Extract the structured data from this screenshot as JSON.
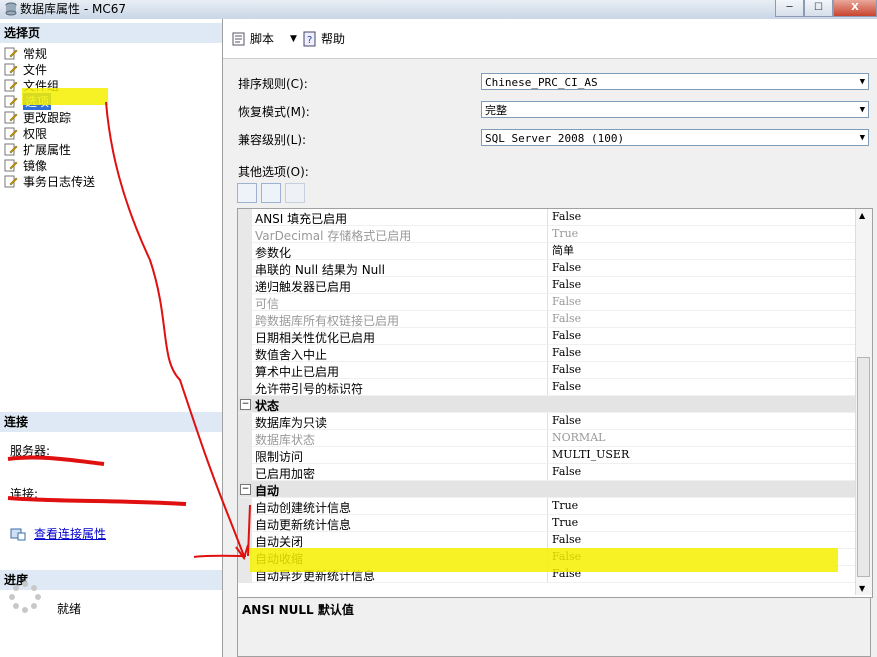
{
  "window": {
    "title": "数据库属性 - MC67",
    "buttons": [
      "─",
      "☐",
      "X"
    ]
  },
  "sidebar": {
    "select_page_header": "选择页",
    "items": [
      {
        "label": "常规"
      },
      {
        "label": "文件"
      },
      {
        "label": "文件组"
      },
      {
        "label": "选项",
        "selected": true
      },
      {
        "label": "更改跟踪"
      },
      {
        "label": "权限"
      },
      {
        "label": "扩展属性"
      },
      {
        "label": "镜像"
      },
      {
        "label": "事务日志传送"
      }
    ],
    "connection_header": "连接",
    "server_label": "服务器:",
    "connection_label": "连接:",
    "view_link": "查看连接属性",
    "progress_header": "进度",
    "status": "就绪"
  },
  "toolbar": {
    "script_label": "脚本",
    "help_label": "帮助"
  },
  "fields": {
    "collation_label": "排序规则(C):",
    "collation_value": "Chinese_PRC_CI_AS",
    "recovery_label": "恢复模式(M):",
    "recovery_value": "完整",
    "compat_label": "兼容级别(L):",
    "compat_value": "SQL Server 2008 (100)",
    "other_label": "其他选项(O):"
  },
  "grid": {
    "rows": [
      {
        "name": "ANSI 填充已启用",
        "value": "False"
      },
      {
        "name": "VarDecimal 存储格式已启用",
        "value": "True",
        "disabled": true
      },
      {
        "name": "参数化",
        "value": "简单"
      },
      {
        "name": "串联的 Null 结果为 Null",
        "value": "False"
      },
      {
        "name": "递归触发器已启用",
        "value": "False"
      },
      {
        "name": "可信",
        "value": "False",
        "disabled": true
      },
      {
        "name": "跨数据库所有权链接已启用",
        "value": "False",
        "disabled": true
      },
      {
        "name": "日期相关性优化已启用",
        "value": "False"
      },
      {
        "name": "数值舍入中止",
        "value": "False"
      },
      {
        "name": "算术中止已启用",
        "value": "False"
      },
      {
        "name": "允许带引号的标识符",
        "value": "False"
      },
      {
        "category": true,
        "name": "状态",
        "toggle": "⊟"
      },
      {
        "name": "数据库为只读",
        "value": "False"
      },
      {
        "name": "数据库状态",
        "value": "NORMAL",
        "disabled": true
      },
      {
        "name": "限制访问",
        "value": "MULTI_USER"
      },
      {
        "name": "已启用加密",
        "value": "False"
      },
      {
        "category": true,
        "name": "自动",
        "toggle": "⊟"
      },
      {
        "name": "自动创建统计信息",
        "value": "True"
      },
      {
        "name": "自动更新统计信息",
        "value": "True"
      },
      {
        "name": "自动关闭",
        "value": "False"
      },
      {
        "name": "自动收缩",
        "value": "False",
        "highlighted": true
      },
      {
        "name": "自动异步更新统计信息",
        "value": "False"
      }
    ],
    "description": "ANSI NULL 默认值"
  },
  "colors": {
    "highlight": "#f4f000",
    "annotation": "#e01010",
    "selection": "#2f6fd6"
  }
}
